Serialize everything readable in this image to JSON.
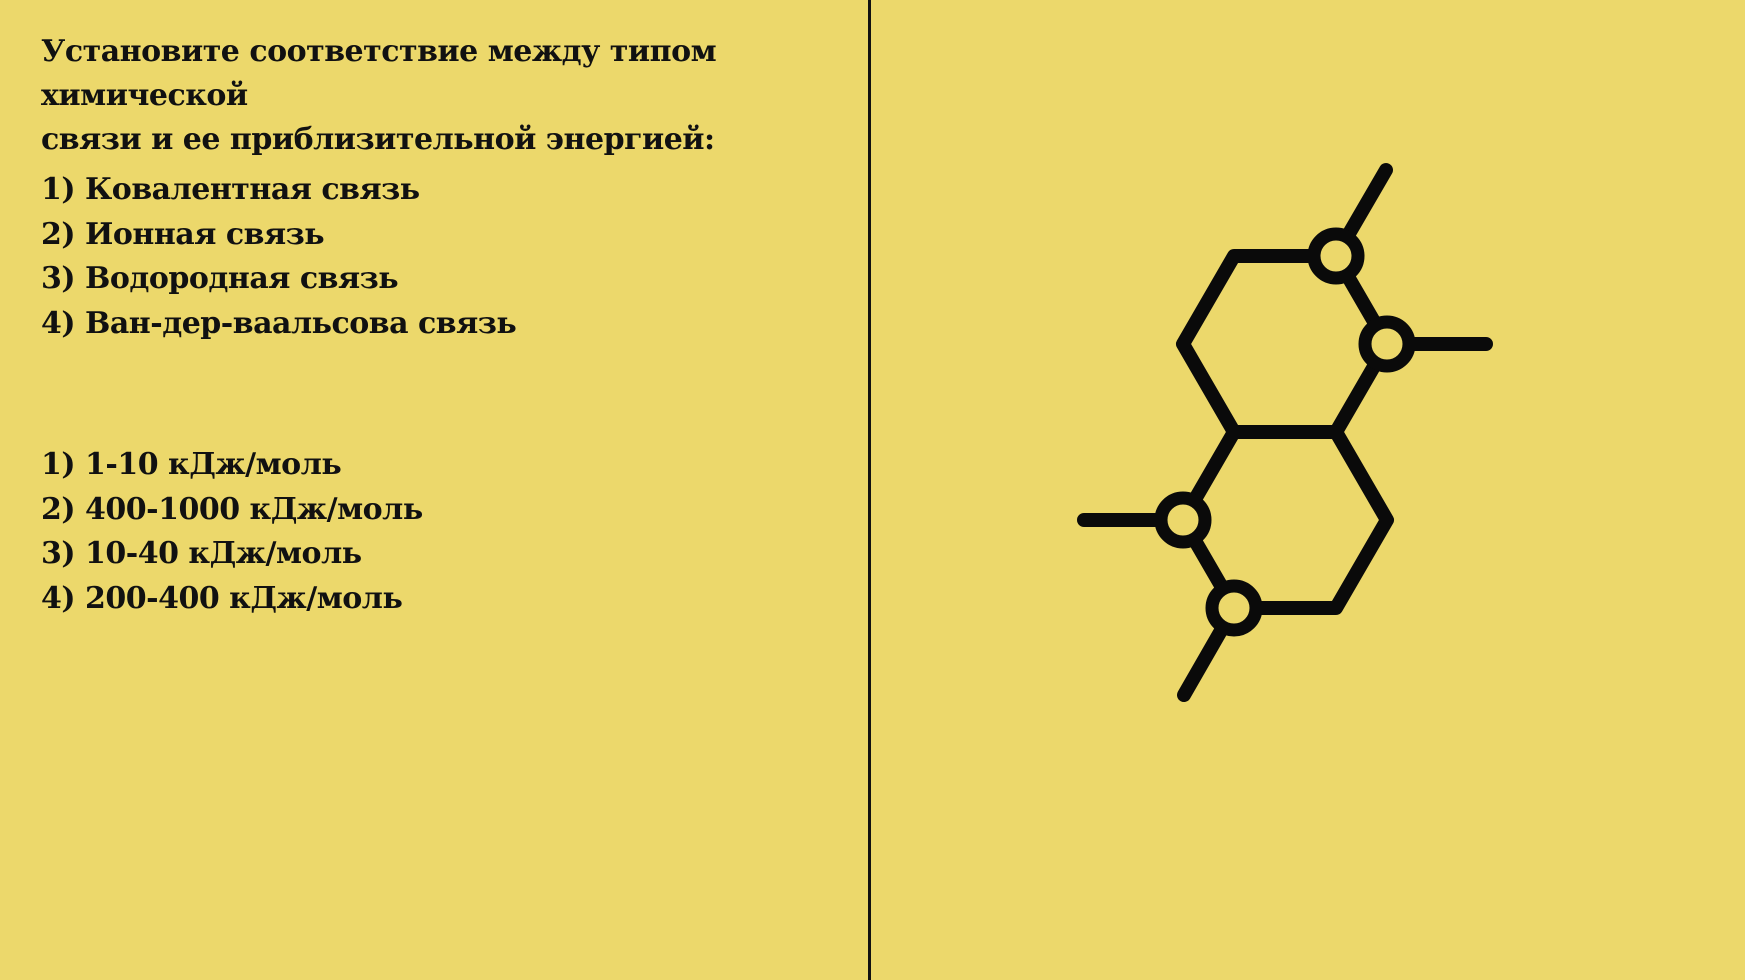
{
  "colors": {
    "background": "#ecd86b",
    "text": "#111111",
    "divider": "#111111",
    "icon": "#0a0a0a"
  },
  "question": {
    "line1": "Установите соответствие между типом химической",
    "line2": "связи и ее приблизительной энергией:"
  },
  "bond_types": [
    "1) Ковалентная связь",
    "2) Ионная связь",
    "3) Водородная связь",
    "4) Ван-дер-ваальсова связь"
  ],
  "energies": [
    "1) 1-10 кДж/моль",
    "2) 400-1000 кДж/моль",
    "3) 10-40 кДж/моль",
    "4) 200-400 кДж/моль"
  ],
  "illustration": {
    "icon": "molecule-icon"
  }
}
